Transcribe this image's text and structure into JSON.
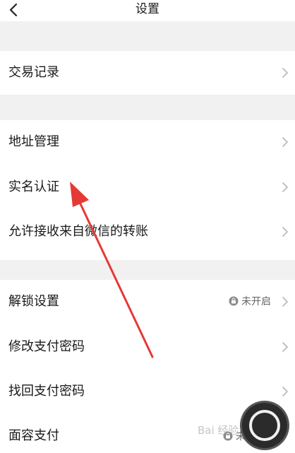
{
  "header": {
    "title": "设置"
  },
  "sections": [
    {
      "items": [
        {
          "label": "交易记录"
        }
      ]
    },
    {
      "items": [
        {
          "label": "地址管理"
        },
        {
          "label": "实名认证"
        },
        {
          "label": "允许接收来自微信的转账"
        }
      ]
    },
    {
      "items": [
        {
          "label": "解锁设置",
          "status": "未开启"
        },
        {
          "label": "修改支付密码"
        },
        {
          "label": "找回支付密码"
        },
        {
          "label": "面容支付",
          "status": "未"
        }
      ]
    }
  ],
  "icons": {
    "back": "chevron-left-icon",
    "row_arrow": "chevron-right-icon",
    "status": "lock-icon"
  },
  "colors": {
    "annotation_arrow": "#e53935",
    "background": "#f1f1f1",
    "row_background": "#ffffff"
  },
  "watermark": "Bai 经验"
}
